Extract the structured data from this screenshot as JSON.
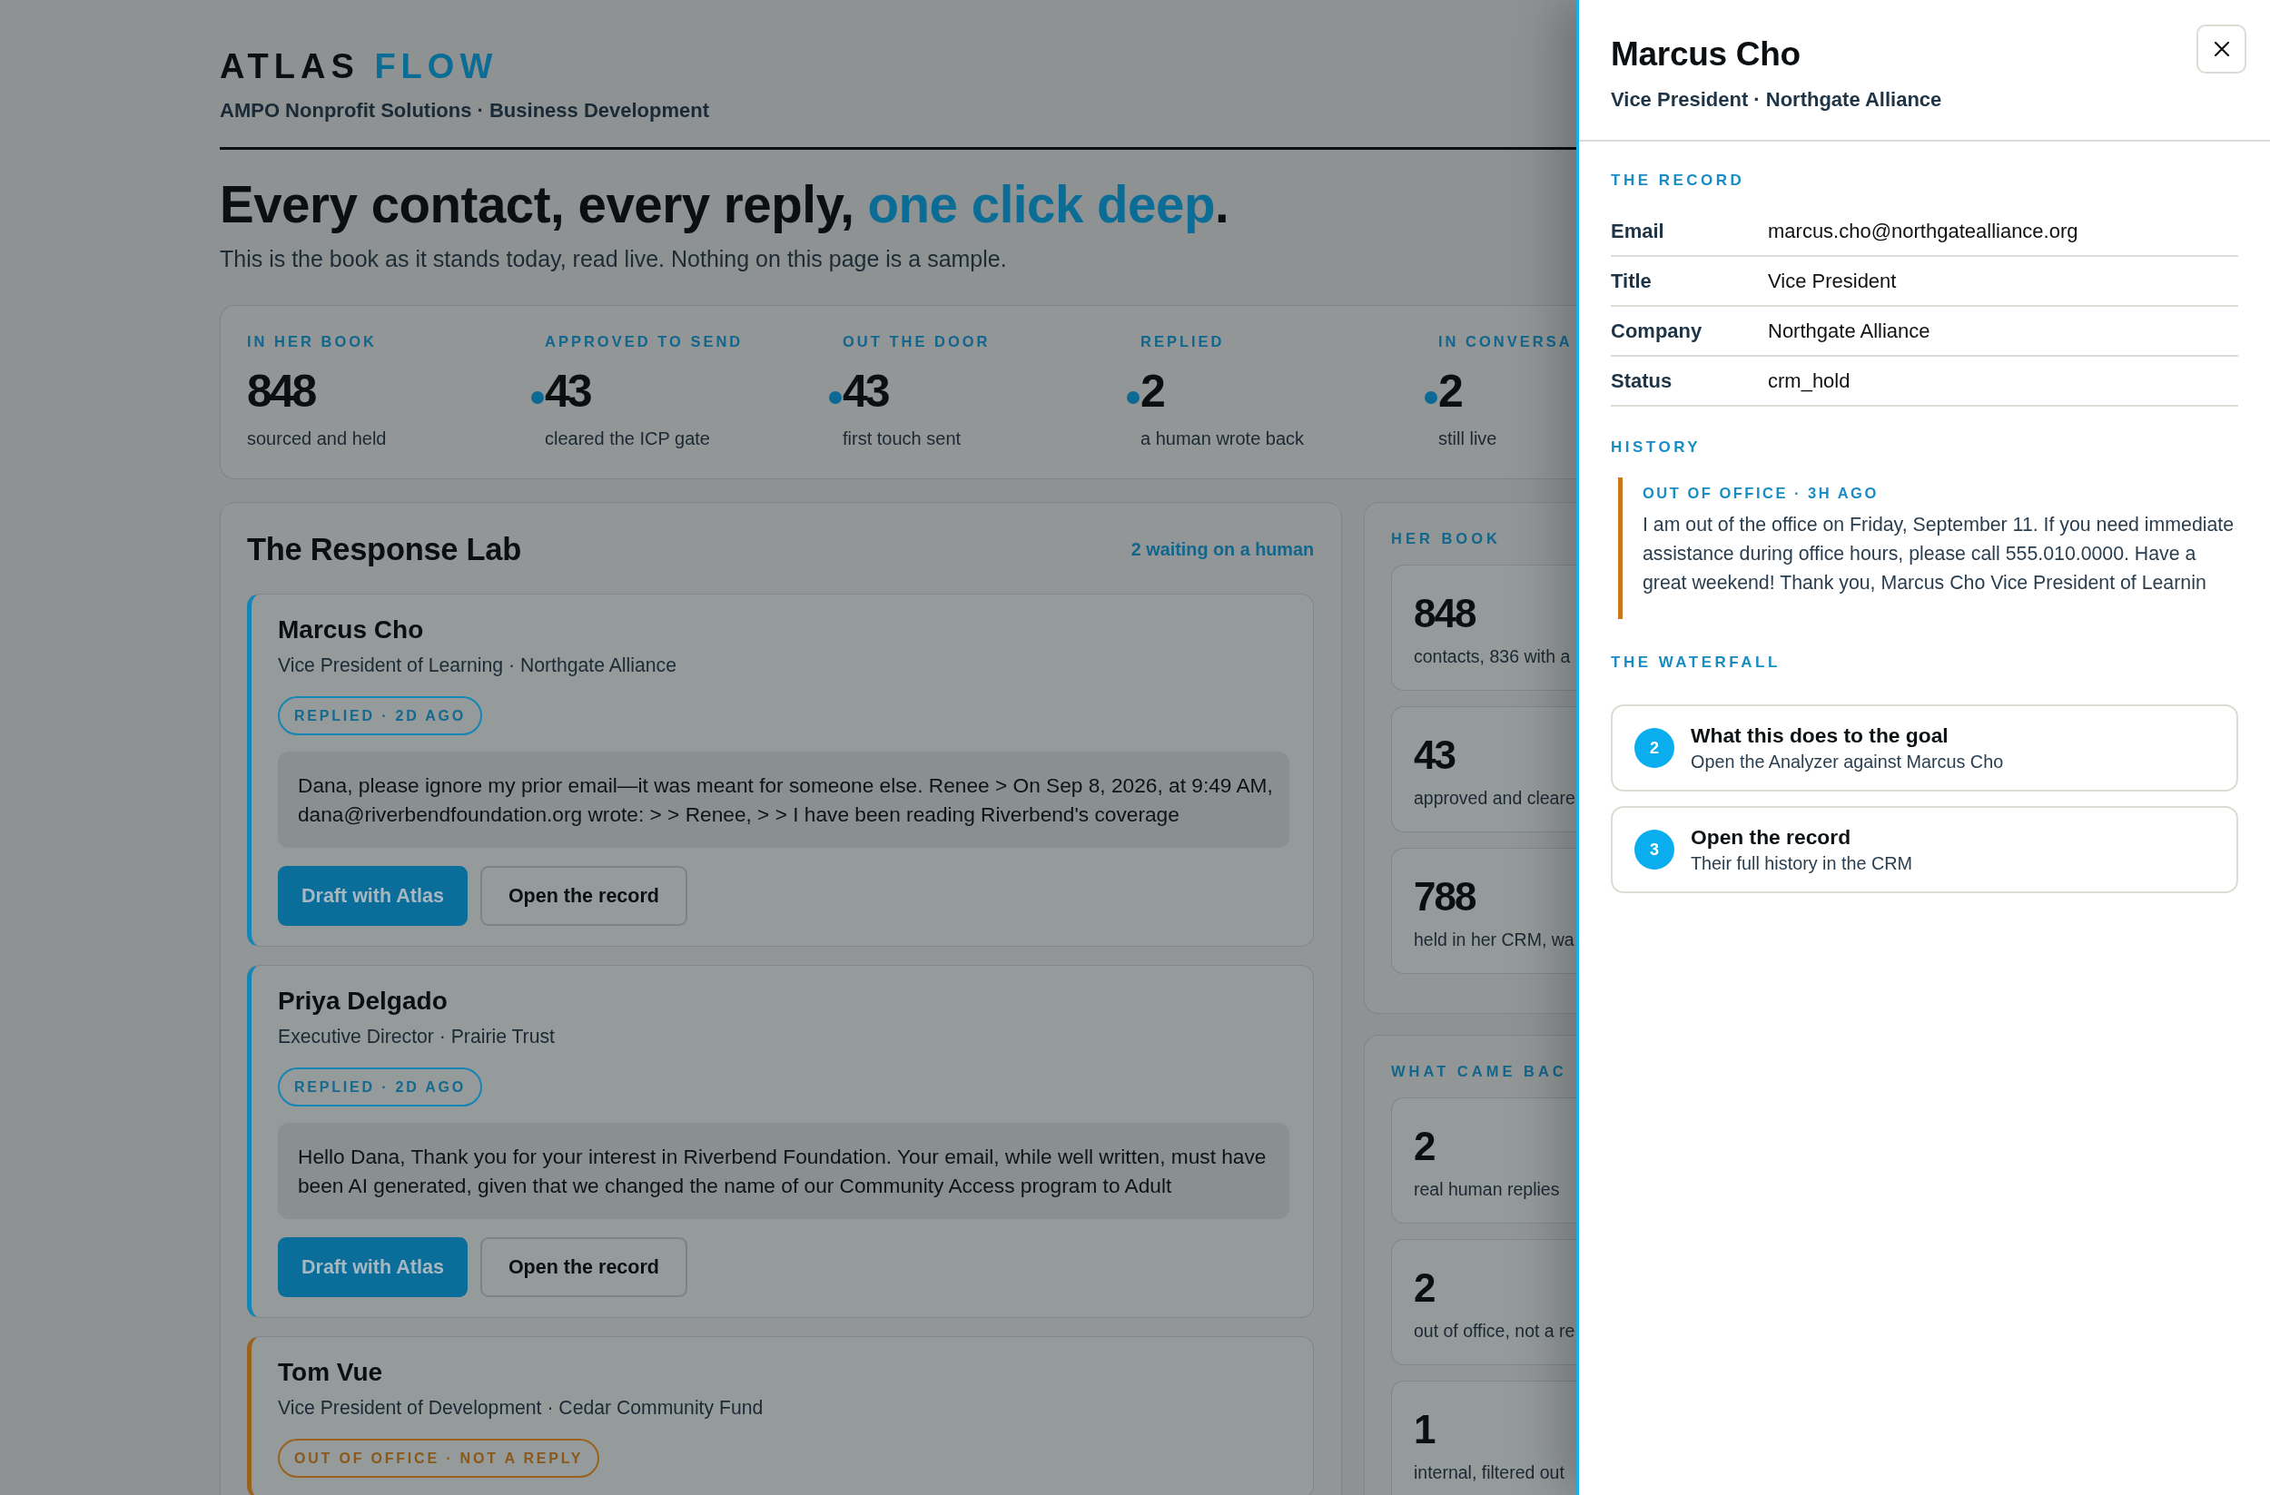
{
  "brand": {
    "name": "ATLAS",
    "accent": "FLOW",
    "subtitle": "AMPO Nonprofit Solutions · Business Development"
  },
  "headline": {
    "lead": "Every contact, every reply, ",
    "accent": "one click deep",
    "tail": "."
  },
  "intro": "This is the book as it stands today, read live. Nothing on this page is a sample.",
  "stats": [
    {
      "label": "IN HER BOOK",
      "value": "848",
      "caption": "sourced and held",
      "dot": false
    },
    {
      "label": "APPROVED TO SEND",
      "value": "43",
      "caption": "cleared the ICP gate",
      "dot": true
    },
    {
      "label": "OUT THE DOOR",
      "value": "43",
      "caption": "first touch sent",
      "dot": true
    },
    {
      "label": "REPLIED",
      "value": "2",
      "caption": "a human wrote back",
      "dot": true
    },
    {
      "label": "IN CONVERSA",
      "value": "2",
      "caption": "still live",
      "dot": true
    }
  ],
  "response_lab": {
    "title": "The Response Lab",
    "waiting": "2 waiting on a human",
    "cards": [
      {
        "kind": "replied",
        "name": "Marcus Cho",
        "role": "Vice President of Learning · Northgate Alliance",
        "status": "REPLIED · 2D AGO",
        "message": "Dana, please ignore my prior email—it was meant for someone else. Renee > On Sep 8, 2026, at 9:49 AM, dana@riverbendfoundation.org wrote: > > Renee, > > I have been reading Riverbend's coverage",
        "buttons": [
          {
            "kind": "primary",
            "label": "Draft with Atlas"
          },
          {
            "kind": "secondary",
            "label": "Open the record"
          }
        ]
      },
      {
        "kind": "replied",
        "name": "Priya Delgado",
        "role": "Executive Director · Prairie Trust",
        "status": "REPLIED · 2D AGO",
        "message": "Hello Dana, Thank you for your interest in Riverbend Foundation. Your email, while well written, must have been AI generated, given that we changed the name of our Community Access program to Adult",
        "buttons": [
          {
            "kind": "primary",
            "label": "Draft with Atlas"
          },
          {
            "kind": "secondary",
            "label": "Open the record"
          }
        ]
      },
      {
        "kind": "out_of_office",
        "name": "Tom Vue",
        "role": "Vice President of Development · Cedar Community Fund",
        "status": "OUT OF OFFICE · NOT A REPLY"
      }
    ]
  },
  "side_panels": [
    {
      "title": "HER BOOK",
      "items": [
        {
          "value": "848",
          "caption": "contacts, 836 with a"
        },
        {
          "value": "43",
          "caption": "approved and cleare"
        },
        {
          "value": "788",
          "caption": "held in her CRM, wa"
        }
      ]
    },
    {
      "title": "WHAT CAME BAC",
      "items": [
        {
          "value": "2",
          "caption": "real human replies"
        },
        {
          "value": "2",
          "caption": "out of office, not a re"
        },
        {
          "value": "1",
          "caption": "internal, filtered out"
        }
      ]
    }
  ],
  "drawer": {
    "title": "Marcus Cho",
    "subtitle": "Vice President · Northgate Alliance",
    "record_title": "THE RECORD",
    "record": [
      {
        "label": "Email",
        "value": "marcus.cho@northgatealliance.org"
      },
      {
        "label": "Title",
        "value": "Vice President"
      },
      {
        "label": "Company",
        "value": "Northgate Alliance"
      },
      {
        "label": "Status",
        "value": "crm_hold"
      }
    ],
    "history_title": "HISTORY",
    "history": [
      {
        "kind": "out_of_office",
        "label": "OUT OF OFFICE · 3H AGO",
        "text": "I am out of the office on Friday, September 11. If you need immediate assistance during office hours, please call 555.010.0000. Have a great weekend! Thank you, Marcus Cho Vice President of Learnin"
      }
    ],
    "waterfall_title": "THE WATERFALL",
    "waterfall": [
      {
        "number": "2",
        "title": "What this does to the goal",
        "description": "Open the Analyzer against Marcus Cho"
      },
      {
        "number": "3",
        "title": "Open the record",
        "description": "Their full history in the CRM"
      }
    ]
  }
}
